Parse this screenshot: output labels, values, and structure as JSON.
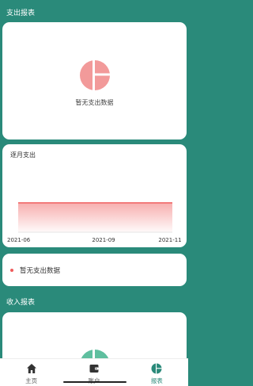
{
  "expense_section": {
    "title": "支出报表",
    "empty_text": "暂无支出数据",
    "pie_color": "#f29a9a"
  },
  "monthly_card": {
    "title": "逐月支出",
    "chart_data": {
      "type": "area",
      "x": [
        "2021-06",
        "2021-09",
        "2021-11"
      ],
      "series": [
        {
          "values": [
            0,
            0,
            0
          ]
        }
      ],
      "color": "#ef5b5b"
    }
  },
  "legend": {
    "text": "暂无支出数据",
    "dot_color": "#ef5b5b"
  },
  "income_section": {
    "title": "收入报表",
    "pie_color": "#5fbf9f"
  },
  "tabs": [
    {
      "label": "主页",
      "icon": "home-icon",
      "active": false
    },
    {
      "label": "账户",
      "icon": "wallet-icon",
      "active": false
    },
    {
      "label": "报表",
      "icon": "pie-chart-icon",
      "active": true
    }
  ]
}
